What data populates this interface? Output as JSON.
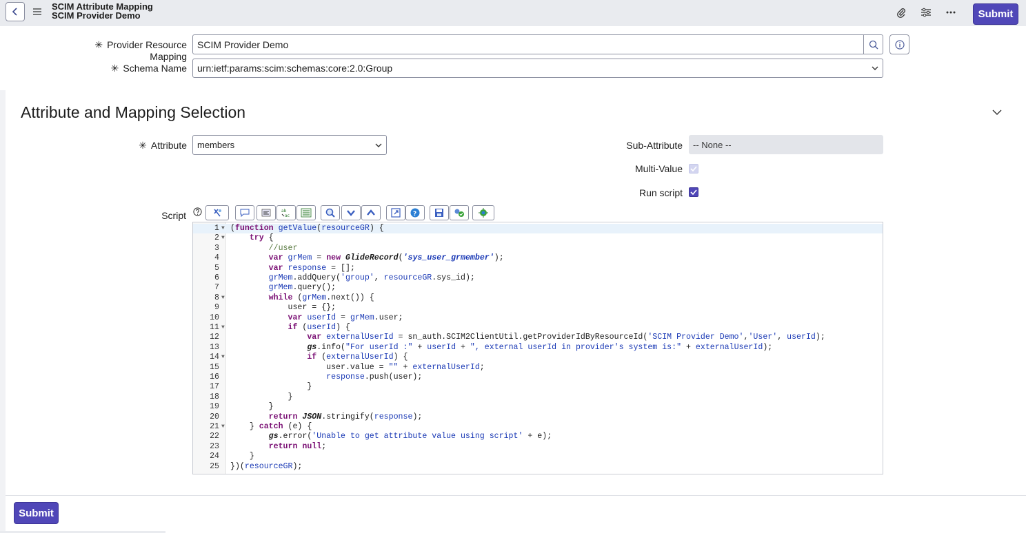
{
  "header": {
    "title": "SCIM Attribute Mapping",
    "subtitle": "SCIM Provider Demo",
    "submit_label": "Submit",
    "icons": [
      "back-icon",
      "menu-icon",
      "paperclip-icon",
      "settings-sliders-icon",
      "more-icon"
    ]
  },
  "form": {
    "provider_label": "Provider Resource Mapping",
    "provider_value": "SCIM Provider Demo",
    "schema_label": "Schema Name",
    "schema_value": "urn:ietf:params:scim:schemas:core:2.0:Group"
  },
  "section": {
    "title": "Attribute and Mapping Selection",
    "attribute_label": "Attribute",
    "attribute_value": "members",
    "sub_attribute_label": "Sub-Attribute",
    "sub_attribute_value": "-- None --",
    "multi_value_label": "Multi-Value",
    "multi_value_checked": true,
    "run_script_label": "Run script",
    "run_script_checked": true,
    "script_label": "Script"
  },
  "toolbar": {
    "buttons": [
      "format-icon",
      "comment-icon",
      "align-icon",
      "replace-icon",
      "replace-all-icon",
      "search-icon",
      "fold-down-icon",
      "fold-up-icon",
      "fullscreen-icon",
      "help-icon",
      "save-icon",
      "check-icon",
      "debug-icon"
    ]
  },
  "script": {
    "lines": [
      "(function getValue(resourceGR) {",
      "    try {",
      "        //user",
      "        var grMem = new GlideRecord('sys_user_grmember');",
      "        var response = [];",
      "        grMem.addQuery('group', resourceGR.sys_id);",
      "        grMem.query();",
      "        while (grMem.next()) {",
      "            user = {};",
      "            var userId = grMem.user;",
      "            if (userId) {",
      "                var externalUserId = sn_auth.SCIM2ClientUtil.getProviderIdByResourceId('SCIM Provider Demo','User', userId);",
      "                gs.info(\"For userId :\" + userId + \", external userId in provider's system is:\" + externalUserId);",
      "                if (externalUserId) {",
      "                    user.value = \"\" + externalUserId;",
      "                    response.push(user);",
      "                }",
      "            }",
      "        }",
      "        return JSON.stringify(response);",
      "    } catch (e) {",
      "        gs.error('Unable to get attribute value using script' + e);",
      "        return null;",
      "    }",
      "})(resourceGR);"
    ],
    "fold_lines": [
      1,
      2,
      8,
      11,
      14,
      21
    ]
  },
  "footer": {
    "submit_label": "Submit"
  },
  "colors": {
    "brand": "#5047b8",
    "header_bg": "#e9ebef"
  }
}
